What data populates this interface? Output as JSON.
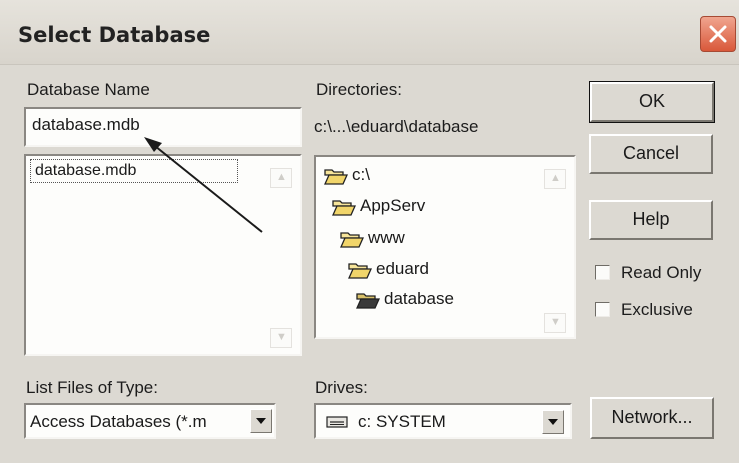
{
  "dialog": {
    "title": "Select Database",
    "close_icon": "close-x-icon",
    "accent_close": "#d9583a"
  },
  "database_name": {
    "label": "Database Name",
    "value": "database.mdb",
    "list": [
      "database.mdb"
    ]
  },
  "directories": {
    "label": "Directories:",
    "current_path": "c:\\...\\eduard\\database",
    "tree": [
      {
        "name": "c:\\",
        "icon": "open-folder-icon"
      },
      {
        "name": "AppServ",
        "icon": "open-folder-icon"
      },
      {
        "name": "www",
        "icon": "open-folder-icon"
      },
      {
        "name": "eduard",
        "icon": "open-folder-icon"
      },
      {
        "name": "database",
        "icon": "open-folder-icon"
      }
    ]
  },
  "buttons": {
    "ok": "OK",
    "cancel": "Cancel",
    "help": "Help",
    "network": "Network..."
  },
  "options": {
    "read_only": {
      "label": "Read Only",
      "checked": false
    },
    "exclusive": {
      "label": "Exclusive",
      "checked": false
    }
  },
  "file_type": {
    "label": "List Files of Type:",
    "selected": "Access Databases (*.m"
  },
  "drives": {
    "label": "Drives:",
    "selected": "c: SYSTEM",
    "icon": "drive-icon"
  }
}
